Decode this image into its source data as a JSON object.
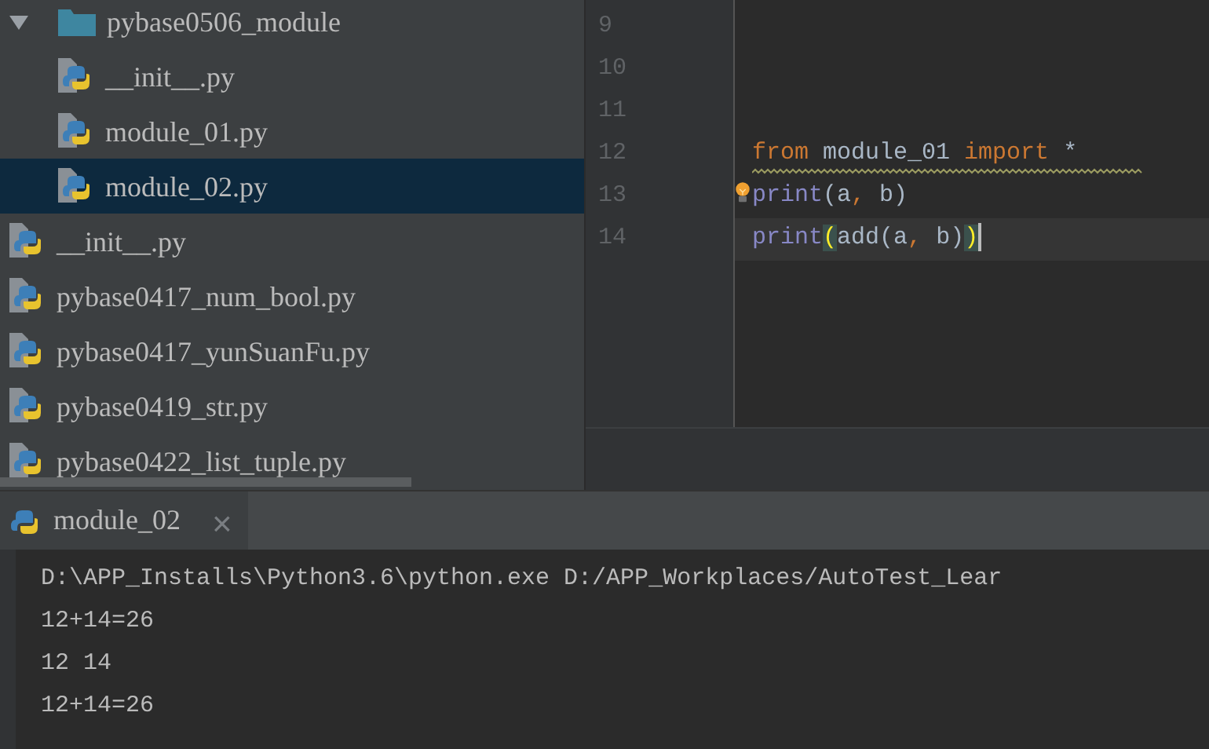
{
  "project_tree": [
    {
      "label": "pybase0506_module",
      "kind": "folder",
      "expanded": true,
      "selected": false,
      "children": [
        {
          "label": "__init__.py",
          "kind": "python",
          "selected": false
        },
        {
          "label": "module_01.py",
          "kind": "python",
          "selected": false
        },
        {
          "label": "module_02.py",
          "kind": "python",
          "selected": true
        }
      ]
    },
    {
      "label": "__init__.py",
      "kind": "python",
      "selected": false
    },
    {
      "label": "pybase0417_num_bool.py",
      "kind": "python",
      "selected": false
    },
    {
      "label": "pybase0417_yunSuanFu.py",
      "kind": "python",
      "selected": false
    },
    {
      "label": "pybase0419_str.py",
      "kind": "python",
      "selected": false
    },
    {
      "label": "pybase0422_list_tuple.py",
      "kind": "python",
      "selected": false
    }
  ],
  "editor": {
    "lines": [
      {
        "number": "9"
      },
      {
        "number": "10"
      },
      {
        "number": "11"
      },
      {
        "number": "12",
        "warning": true,
        "tokens": [
          {
            "text": "from",
            "kind": "keyword"
          },
          {
            "text": " module_01 ",
            "kind": "plain"
          },
          {
            "text": "import",
            "kind": "keyword"
          },
          {
            "text": " *",
            "kind": "plain"
          }
        ]
      },
      {
        "number": "13",
        "bulb": true,
        "tokens": [
          {
            "text": "print",
            "kind": "builtin"
          },
          {
            "text": "(a",
            "kind": "plain"
          },
          {
            "text": ",",
            "kind": "comma"
          },
          {
            "text": " b)",
            "kind": "plain"
          }
        ]
      },
      {
        "number": "14",
        "current": true,
        "tokens": [
          {
            "text": "print",
            "kind": "builtin"
          },
          {
            "text": "(",
            "kind": "brace"
          },
          {
            "text": "add(a",
            "kind": "plain"
          },
          {
            "text": ",",
            "kind": "comma"
          },
          {
            "text": " b)",
            "kind": "plain"
          },
          {
            "text": ")",
            "kind": "brace"
          }
        ]
      }
    ]
  },
  "run_panel": {
    "tabs": [
      {
        "label": "module_02",
        "selected": true,
        "close": "×"
      }
    ],
    "output": [
      "D:\\APP_Installs\\Python3.6\\python.exe D:/APP_Workplaces/AutoTest_Lear",
      "12+14=26",
      "12 14",
      "12+14=26"
    ]
  }
}
